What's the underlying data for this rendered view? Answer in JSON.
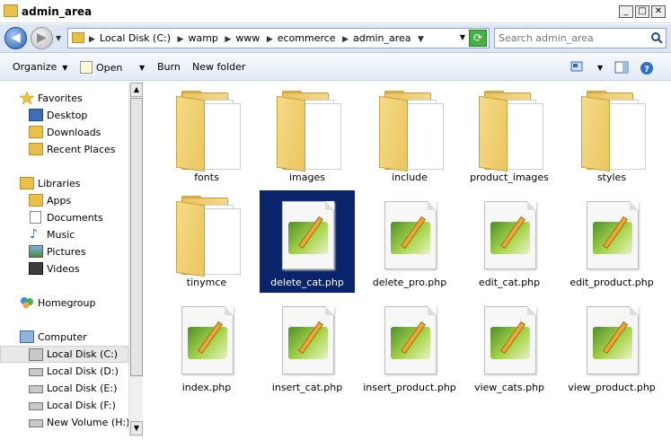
{
  "window": {
    "title": "admin_area"
  },
  "address": {
    "crumbs": [
      "Local Disk (C:)",
      "wamp",
      "www",
      "ecommerce",
      "admin_area"
    ]
  },
  "search": {
    "placeholder": "Search admin_area"
  },
  "toolbar": {
    "organize": "Organize",
    "open": "Open",
    "burn": "Burn",
    "new_folder": "New folder"
  },
  "nav": {
    "favorites": {
      "label": "Favorites",
      "items": [
        "Desktop",
        "Downloads",
        "Recent Places"
      ]
    },
    "libraries": {
      "label": "Libraries",
      "items": [
        "Apps",
        "Documents",
        "Music",
        "Pictures",
        "Videos"
      ]
    },
    "homegroup": "Homegroup",
    "computer": {
      "label": "Computer",
      "items": [
        "Local Disk (C:)",
        "Local Disk (D:)",
        "Local Disk (E:)",
        "Local Disk (F:)",
        "New Volume (H:)"
      ]
    },
    "selected": "Local Disk (C:)"
  },
  "files": [
    {
      "name": "fonts",
      "type": "folder"
    },
    {
      "name": "images",
      "type": "folder"
    },
    {
      "name": "include",
      "type": "folder"
    },
    {
      "name": "product_images",
      "type": "folder"
    },
    {
      "name": "styles",
      "type": "folder"
    },
    {
      "name": "tinymce",
      "type": "folder"
    },
    {
      "name": "delete_cat.php",
      "type": "php",
      "selected": true
    },
    {
      "name": "delete_pro.php",
      "type": "php"
    },
    {
      "name": "edit_cat.php",
      "type": "php"
    },
    {
      "name": "edit_product.php",
      "type": "php"
    },
    {
      "name": "index.php",
      "type": "php"
    },
    {
      "name": "insert_cat.php",
      "type": "php"
    },
    {
      "name": "insert_product.php",
      "type": "php"
    },
    {
      "name": "view_cats.php",
      "type": "php"
    },
    {
      "name": "view_product.php",
      "type": "php"
    }
  ],
  "colors": {
    "selection": "#0a246a",
    "toolbar": "#e3ebf6",
    "folder": "#eac65f"
  }
}
